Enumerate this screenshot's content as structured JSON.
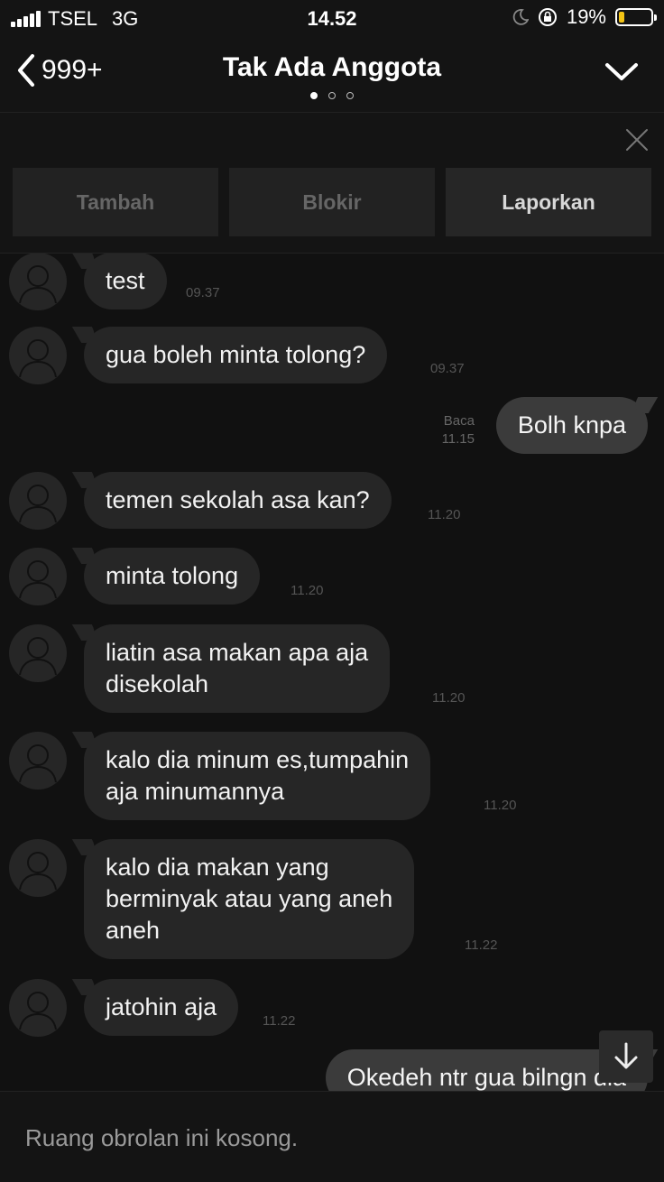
{
  "status_bar": {
    "carrier": "TSEL",
    "network": "3G",
    "time": "14.52",
    "battery": "19%",
    "battery_level": 0.19,
    "icons": [
      "signal-icon",
      "moon-icon",
      "orientation-lock-icon",
      "battery-icon"
    ]
  },
  "header": {
    "back_count": "999+",
    "title": "Tak Ada Anggota",
    "page_dots": 3,
    "active_dot": 0,
    "icons": [
      "back-chevron-icon",
      "chevron-down-icon"
    ]
  },
  "action_bar": {
    "buttons": [
      "Tambah",
      "Blokir",
      "Laporkan"
    ],
    "icons": [
      "close-icon"
    ]
  },
  "messages": [
    {
      "side": "received",
      "text": "test",
      "time": "09.37"
    },
    {
      "side": "received",
      "text": "gua boleh minta tolong?",
      "time": "09.37"
    },
    {
      "side": "sent",
      "text": "Bolh knpa",
      "read": "Baca",
      "time": "11.15"
    },
    {
      "side": "received",
      "text": "temen sekolah asa kan?",
      "time": "11.20"
    },
    {
      "side": "received",
      "text": "minta tolong",
      "time": "11.20"
    },
    {
      "side": "received",
      "text": "liatin asa makan apa aja\ndisekolah",
      "time": "11.20"
    },
    {
      "side": "received",
      "text": "kalo dia minum es,tumpahin\naja minumannya",
      "time": "11.20"
    },
    {
      "side": "received",
      "text": "kalo dia makan yang\nberminyak atau yang aneh\naneh",
      "time": "11.22"
    },
    {
      "side": "received",
      "text": "jatohin aja",
      "time": "11.22"
    },
    {
      "side": "sent",
      "text": "Okedeh ntr gua bilngn dia"
    }
  ],
  "footer": {
    "empty_text": "Ruang obrolan ini kosong."
  },
  "colors": {
    "background": "#111111",
    "received_bubble": "#262626",
    "sent_bubble": "#3b3b3b",
    "battery_fill": "#f3c415"
  }
}
